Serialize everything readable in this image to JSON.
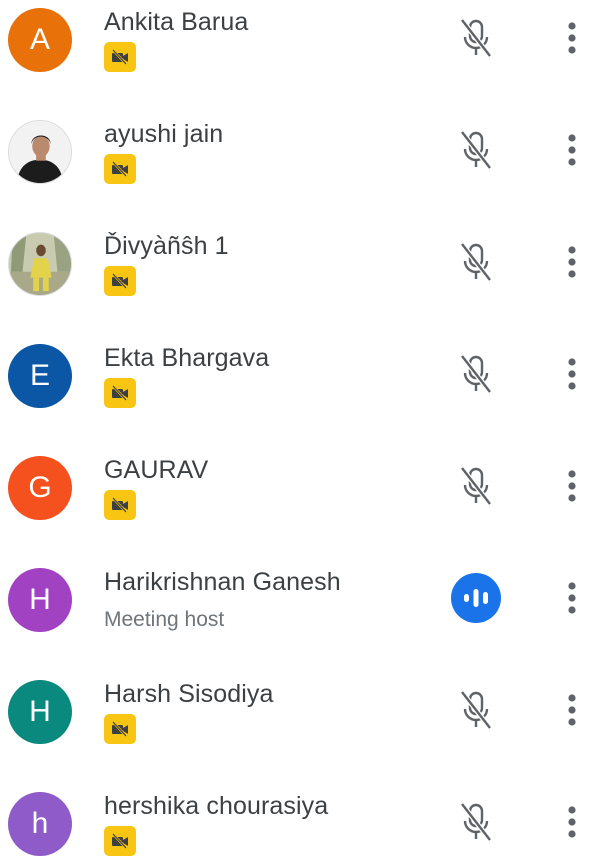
{
  "participants": [
    {
      "name": "Ankita Barua",
      "avatar_initial": "A",
      "avatar_color": "#e8710a",
      "avatar_type": "initial",
      "status": "camera-off",
      "mic": "muted"
    },
    {
      "name": "ayushi jain",
      "avatar_initial": "",
      "avatar_color": "",
      "avatar_type": "photo",
      "status": "camera-off",
      "mic": "muted"
    },
    {
      "name": "Ďivyàñŝh 1",
      "avatar_initial": "",
      "avatar_color": "",
      "avatar_type": "photo",
      "status": "camera-off",
      "mic": "muted"
    },
    {
      "name": "Ekta Bhargava",
      "avatar_initial": "E",
      "avatar_color": "#0b57a5",
      "avatar_type": "initial",
      "status": "camera-off",
      "mic": "muted"
    },
    {
      "name": "GAURAV",
      "avatar_initial": "G",
      "avatar_color": "#f4511e",
      "avatar_type": "initial",
      "status": "camera-off",
      "mic": "muted"
    },
    {
      "name": "Harikrishnan Ganesh",
      "avatar_initial": "H",
      "avatar_color": "#a142c3",
      "avatar_type": "initial",
      "status": "host",
      "subtitle": "Meeting host",
      "mic": "speaking"
    },
    {
      "name": "Harsh Sisodiya",
      "avatar_initial": "H",
      "avatar_color": "#0a8a7e",
      "avatar_type": "initial",
      "status": "camera-off",
      "mic": "muted"
    },
    {
      "name": "hershika chourasiya",
      "avatar_initial": "h",
      "avatar_color": "#8e5bc8",
      "avatar_type": "initial",
      "status": "camera-off",
      "mic": "muted"
    }
  ],
  "icons": {
    "mic_muted": "mic-off-icon",
    "speaking": "audio-level-icon",
    "more": "more-vert-icon",
    "camera_off": "videocam-off-icon"
  },
  "colors": {
    "text": "#3c4043",
    "subtext": "#70757a",
    "icon": "#5f6368",
    "badge": "#f9c513",
    "speaking": "#1a73e8"
  }
}
